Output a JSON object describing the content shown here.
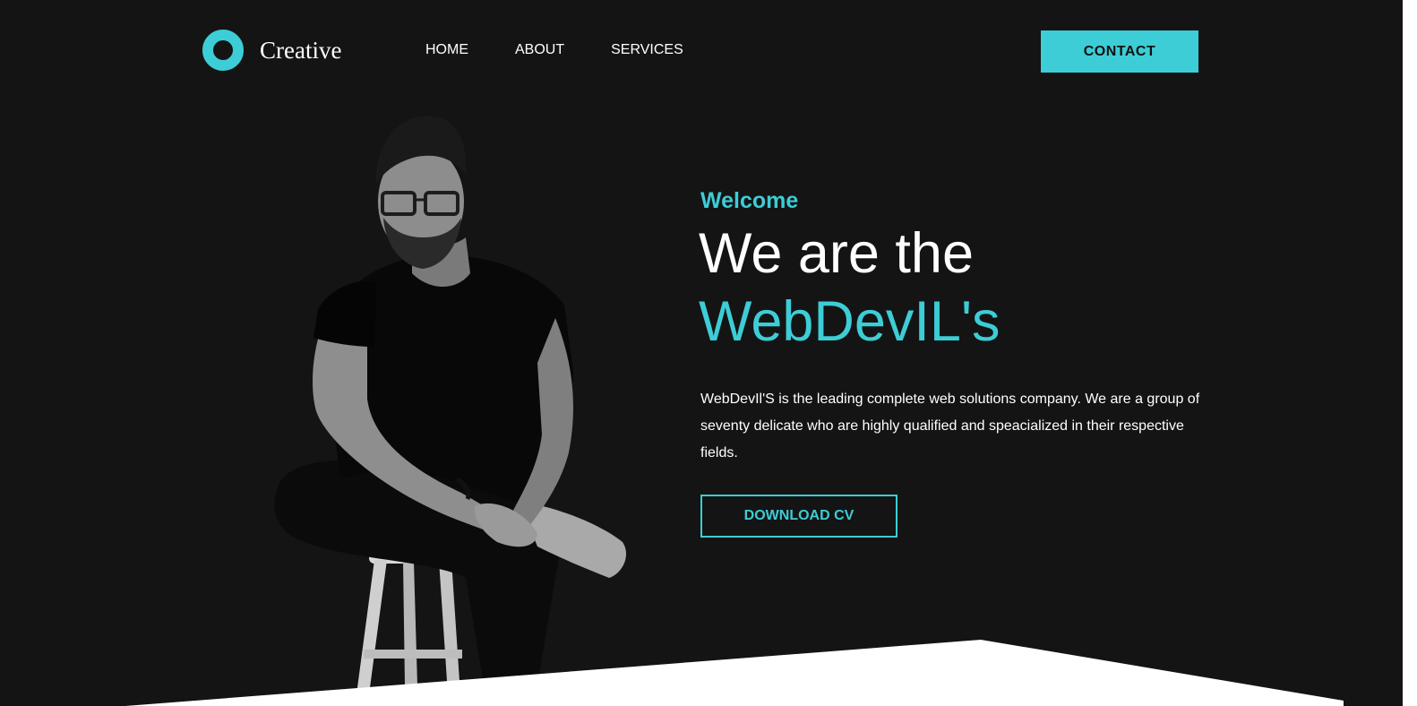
{
  "header": {
    "brand": "Creative",
    "nav": {
      "home": "HOME",
      "about": "ABOUT",
      "services": "SERVICES"
    },
    "contact_label": "CONTACT"
  },
  "hero": {
    "welcome": "Welcome",
    "headline_line1": "We are the",
    "headline_line2": "WebDevIL's",
    "description": "WebDevIl'S is the leading complete web solutions company. We are a group of seventy delicate who are highly qualified and speacialized in their respective fields.",
    "download_label": "DOWNLOAD CV"
  },
  "colors": {
    "background": "#141414",
    "accent": "#3dcdd6",
    "text": "#ffffff"
  },
  "icons": {
    "logo": "ring-logo-icon"
  }
}
